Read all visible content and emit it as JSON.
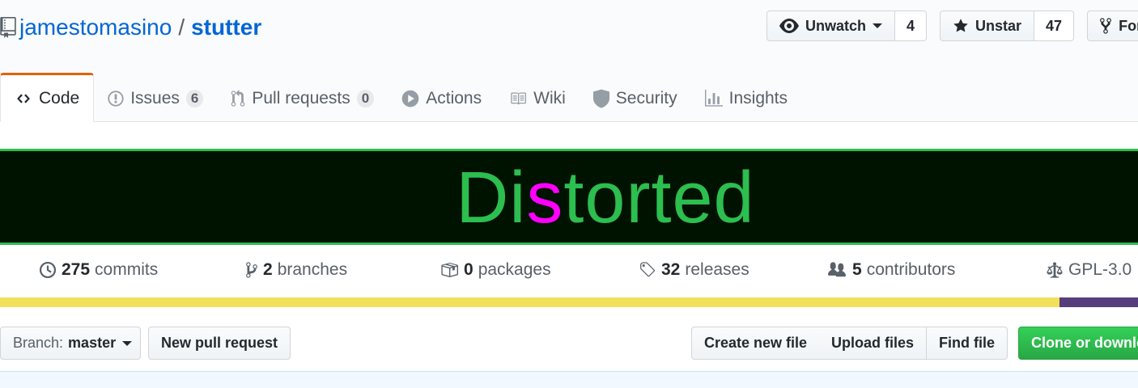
{
  "repo": {
    "owner": "jamestomasino",
    "separator": "/",
    "name": "stutter"
  },
  "actions": {
    "watch": {
      "label": "Unwatch",
      "count": "4"
    },
    "star": {
      "label": "Unstar",
      "count": "47"
    },
    "fork": {
      "label": "Fork"
    }
  },
  "tabs": [
    {
      "label": "Code",
      "icon": "code-icon"
    },
    {
      "label": "Issues",
      "counter": "6",
      "icon": "issue-icon"
    },
    {
      "label": "Pull requests",
      "counter": "0",
      "icon": "pull-request-icon"
    },
    {
      "label": "Actions",
      "icon": "play-icon"
    },
    {
      "label": "Wiki",
      "icon": "book-icon"
    },
    {
      "label": "Security",
      "icon": "shield-icon"
    },
    {
      "label": "Insights",
      "icon": "graph-icon"
    }
  ],
  "banner": {
    "pre": "Di",
    "mid": "s",
    "post": "torted",
    "color": "#2cbe4e",
    "highlight_color": "#ff00ff",
    "background": "#001200"
  },
  "summary": {
    "commits": {
      "num": "275",
      "label": "commits"
    },
    "branches": {
      "num": "2",
      "label": "branches"
    },
    "packages": {
      "num": "0",
      "label": "packages"
    },
    "releases": {
      "num": "32",
      "label": "releases"
    },
    "contributors": {
      "num": "5",
      "label": "contributors"
    },
    "license": {
      "label": "GPL-3.0"
    }
  },
  "languages": [
    {
      "color": "#f1e05a"
    },
    {
      "color": "#563d7c"
    }
  ],
  "filebar": {
    "branch_prefix": "Branch:",
    "branch": "master",
    "new_pr": "New pull request",
    "create_file": "Create new file",
    "upload_files": "Upload files",
    "find_file": "Find file",
    "clone": "Clone or download"
  }
}
